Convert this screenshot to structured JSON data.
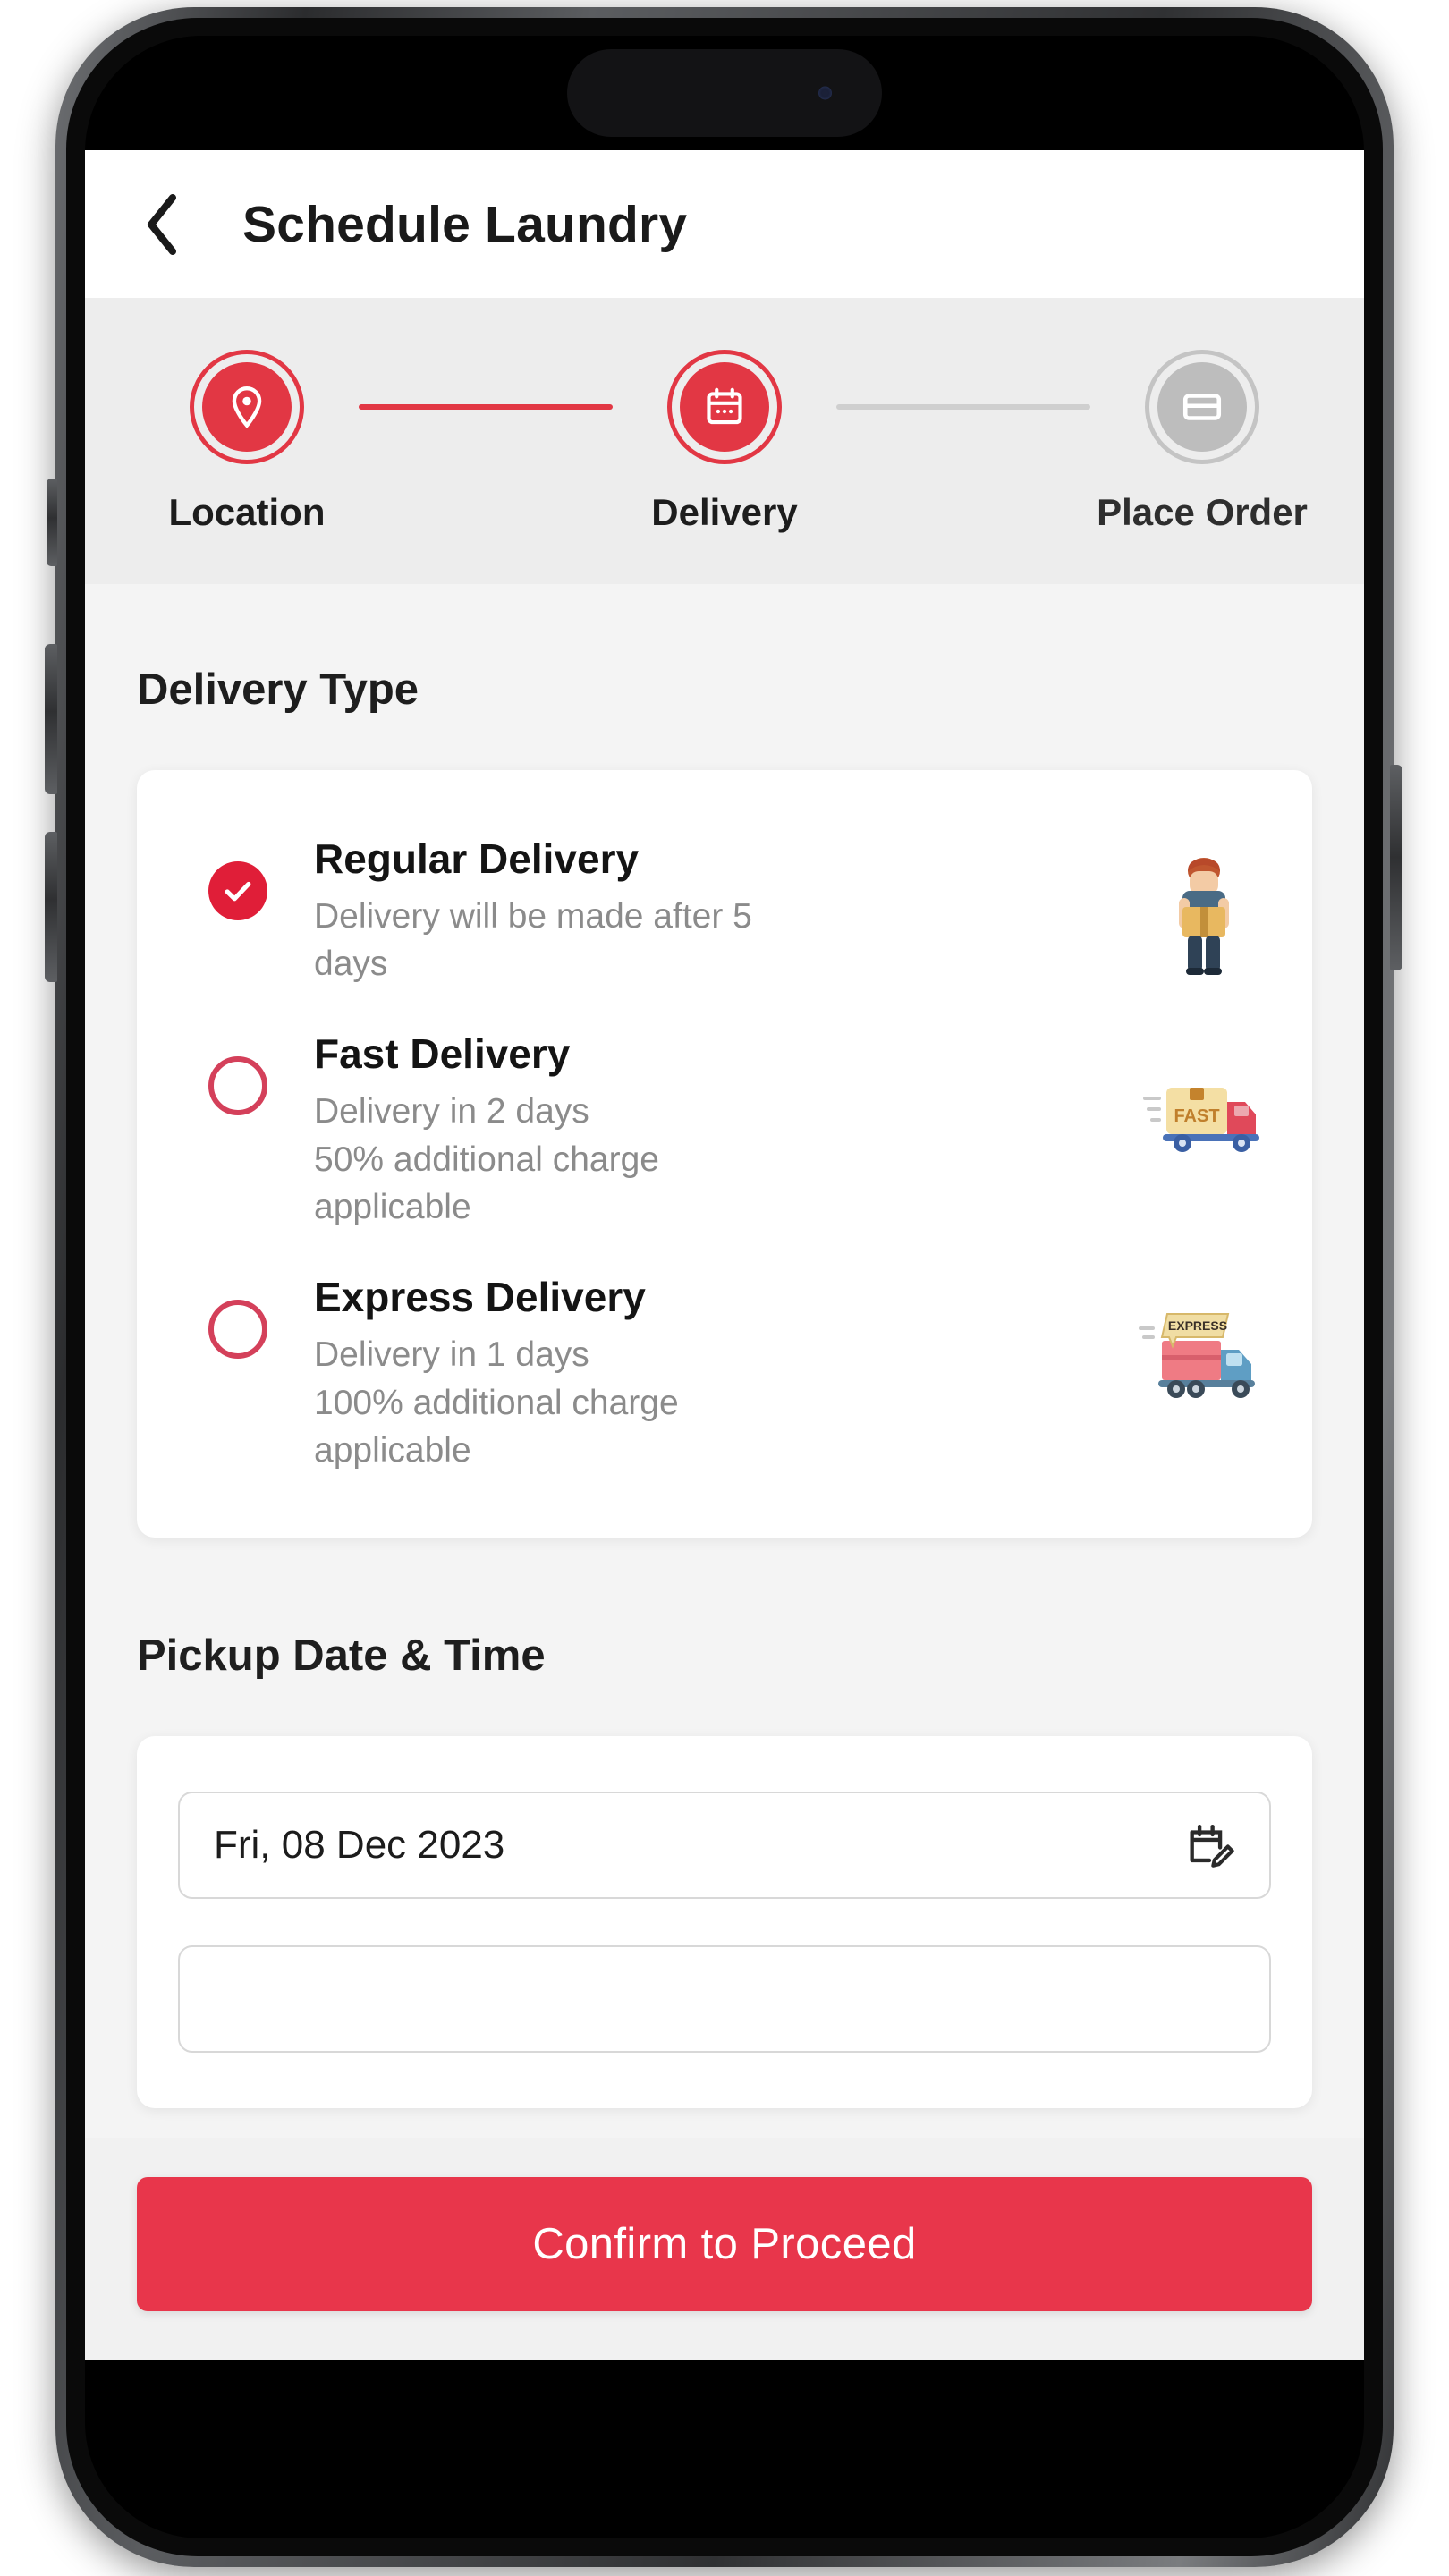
{
  "app": {
    "title": "Schedule Laundry",
    "back_icon": "chevron-left-icon"
  },
  "stepper": {
    "steps": [
      {
        "label": "Location",
        "icon": "map-pin-icon",
        "state": "active"
      },
      {
        "label": "Delivery",
        "icon": "calendar-icon",
        "state": "active"
      },
      {
        "label": "Place Order",
        "icon": "credit-card-icon",
        "state": "inactive"
      }
    ],
    "connectors": [
      "done",
      "pending"
    ],
    "active_color": "#e23744",
    "inactive_color": "#bdbdbd"
  },
  "delivery_type": {
    "section_title": "Delivery Type",
    "options": [
      {
        "title": "Regular Delivery",
        "description": "Delivery will be made after 5 days",
        "selected": true,
        "art": "delivery-person-illustration"
      },
      {
        "title": "Fast Delivery",
        "description": "Delivery in 2 days\n50%  additional charge applicable",
        "selected": false,
        "art": "fast-truck-illustration",
        "badge_text": "FAST"
      },
      {
        "title": "Express Delivery",
        "description": "Delivery in 1 days\n100%  additional charge applicable",
        "selected": false,
        "art": "express-truck-illustration",
        "badge_text": "EXPRESS"
      }
    ]
  },
  "pickup": {
    "section_title": "Pickup Date & Time",
    "date_value": "Fri, 08 Dec 2023",
    "date_icon": "calendar-edit-icon"
  },
  "cta": {
    "label": "Confirm to Proceed",
    "color": "#e8364b"
  }
}
